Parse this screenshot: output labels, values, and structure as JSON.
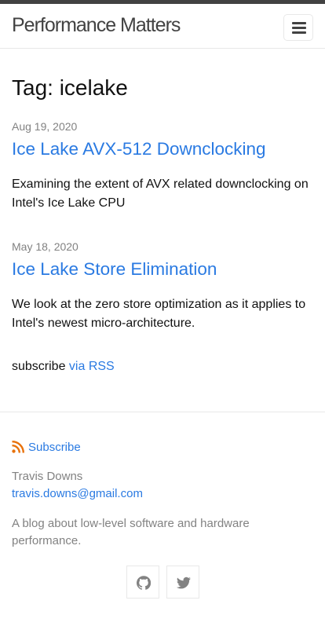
{
  "header": {
    "site_title": "Performance Matters",
    "menu_icon": "hamburger-menu-icon"
  },
  "page": {
    "heading": "Tag: icelake"
  },
  "posts": [
    {
      "date": "Aug 19, 2020",
      "title": "Ice Lake AVX-512 Downclocking",
      "excerpt": "Examining the extent of AVX related downclocking on Intel's Ice Lake CPU"
    },
    {
      "date": "May 18, 2020",
      "title": "Ice Lake Store Elimination",
      "excerpt": "We look at the zero store optimization as it applies to Intel's newest micro-architecture."
    }
  ],
  "subscribe": {
    "prefix": "subscribe ",
    "link_label": "via RSS"
  },
  "footer": {
    "feed_icon": "rss-feed-icon",
    "feed_label": "Subscribe",
    "author_name": "Travis Downs",
    "author_email": "travis.downs@gmail.com",
    "description": "A blog about low-level software and hardware performance.",
    "social": [
      {
        "icon": "github-icon"
      },
      {
        "icon": "twitter-icon"
      }
    ]
  },
  "colors": {
    "link": "#2a7ae2",
    "muted": "#828282",
    "text": "#111111",
    "topbar": "#424242",
    "rss": "#e8720c"
  }
}
